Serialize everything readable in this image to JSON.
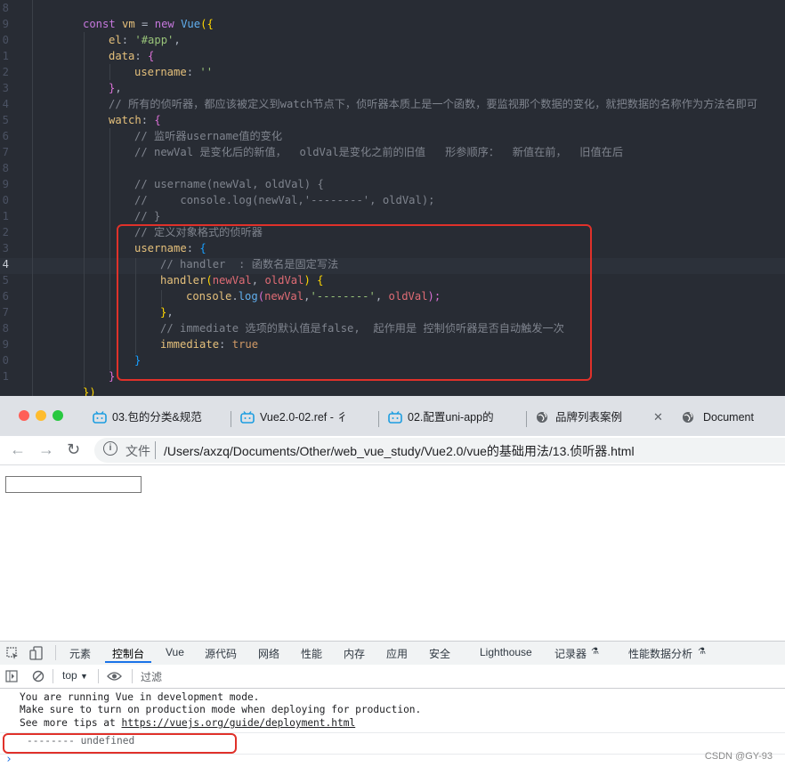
{
  "editor": {
    "line_numbers": [
      "8",
      "9",
      "0",
      "1",
      "2",
      "3",
      "4",
      "5",
      "6",
      "7",
      "8",
      "9",
      "0",
      "1",
      "2",
      "3",
      "4",
      "5",
      "6",
      "7",
      "8",
      "9",
      "0",
      "1"
    ],
    "lines": {
      "l18": "",
      "l19a": "const ",
      "l19b": "vm",
      "l19c": " = ",
      "l19d": "new ",
      "l19e": "Vue",
      "l19f": "({",
      "l20a": "el",
      "l20b": ": ",
      "l20c": "'#app'",
      "l20d": ",",
      "l21a": "data",
      "l21b": ": ",
      "l21c": "{",
      "l22a": "username",
      "l22b": ": ",
      "l22c": "''",
      "l23a": "}",
      "l23b": ",",
      "l24": "// 所有的侦听器，都应该被定义到watch节点下，侦听器本质上是一个函数，要监视那个数据的变化，就把数据的名称作为方法名即可",
      "l25a": "watch",
      "l25b": ": ",
      "l25c": "{",
      "l26": "// 监听器username值的变化",
      "l27": "// newVal 是变化后的新值，  oldVal是变化之前的旧值   形参顺序：  新值在前，  旧值在后",
      "l29": "// username(newVal, oldVal) {",
      "l30": "//     console.log(newVal,'--------', oldVal);",
      "l31": "// }",
      "l32": "// 定义对象格式的侦听器",
      "l33a": "username",
      "l33b": ": ",
      "l33c": "{",
      "l34": "// handler  : 函数名是固定写法",
      "l35a": "handler",
      "l35b": "(",
      "l35c": "newVal",
      "l35d": ", ",
      "l35e": "oldVal",
      "l35f": ") ",
      "l35g": "{",
      "l36a": "console",
      "l36b": ".",
      "l36c": "log",
      "l36d": "(",
      "l36e": "newVal",
      "l36f": ",",
      "l36g": "'--------'",
      "l36h": ", ",
      "l36i": "oldVal",
      "l36j": ");",
      "l37a": "}",
      "l37b": ",",
      "l38": "// immediate 选项的默认值是false,  起作用是 控制侦听器是否自动触发一次",
      "l39a": "immediate",
      "l39b": ": ",
      "l39c": "true",
      "l40": "}",
      "l41": "}",
      "l42": "})"
    }
  },
  "browser": {
    "tabs": [
      {
        "label": "03.包的分类&规范"
      },
      {
        "label": "Vue2.0-02.ref - 彳"
      },
      {
        "label": "02.配置uni-app的"
      },
      {
        "label": "品牌列表案例"
      },
      {
        "label": "Document"
      }
    ],
    "address": {
      "info_label": "文件",
      "url": "/Users/axzq/Documents/Other/web_vue_study/Vue2.0/vue的基础用法/13.侦听器.html"
    }
  },
  "devtools": {
    "tabs": [
      "元素",
      "控制台",
      "Vue",
      "源代码",
      "网络",
      "性能",
      "内存",
      "应用",
      "安全",
      "Lighthouse",
      "记录器",
      "性能数据分析"
    ],
    "active_tab": "控制台",
    "context": "top",
    "filter_placeholder": "过滤",
    "console_lines": [
      "You are running Vue in development mode.",
      "Make sure to turn on production mode when deploying for production.",
      "See more tips at "
    ],
    "console_link": "https://vuejs.org/guide/deployment.html",
    "log_output": "-------- undefined",
    "prompt": "›"
  },
  "watermark": "CSDN @GY-93",
  "colors": {
    "highlight_box": "#e0312a",
    "editor_bg": "#282c34",
    "active_tab_underline": "#1a73e8"
  }
}
